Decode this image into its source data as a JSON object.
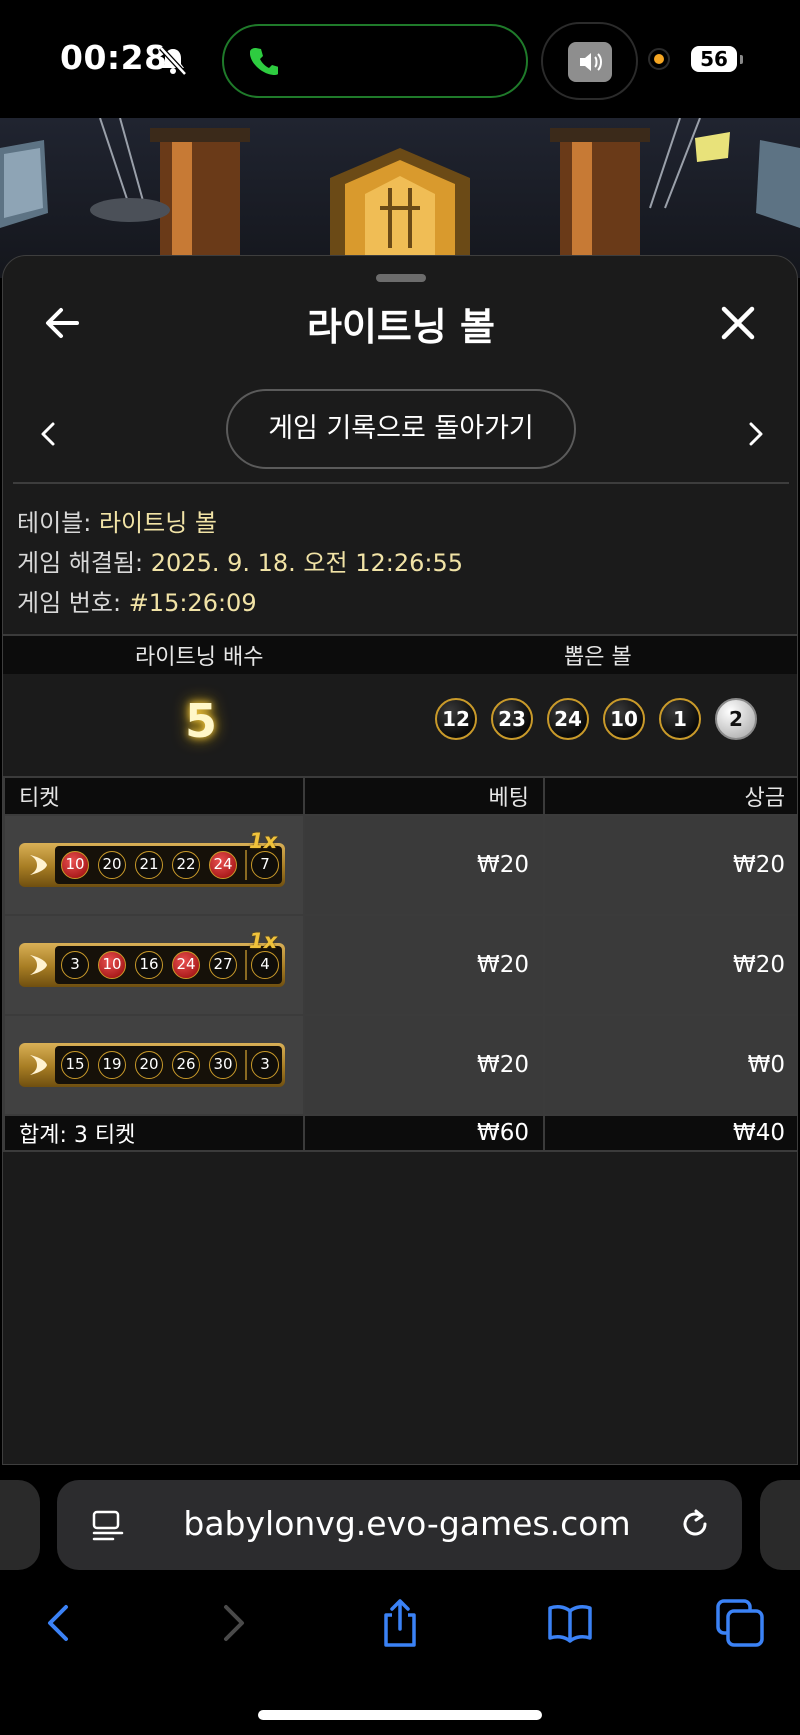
{
  "status_bar": {
    "time": "00:28",
    "battery": "56",
    "icons": [
      "bell-slash-icon",
      "phone-icon",
      "speaker-icon",
      "orange-dot-indicator"
    ]
  },
  "header": {
    "title": "라이트닝 볼",
    "back_icon": "arrow-left-icon",
    "close_icon": "close-icon"
  },
  "nav": {
    "back_to_history": "게임 기록으로 돌아가기",
    "prev_icon": "chevron-left-icon",
    "next_icon": "chevron-right-icon"
  },
  "info": {
    "table_label": "테이블:",
    "table_value": "라이트닝 볼",
    "resolved_label": "게임 해결됨:",
    "resolved_value": "2025. 9. 18. 오전 12:26:55",
    "game_no_label": "게임 번호:",
    "game_no_value": "#15:26:09"
  },
  "result": {
    "multiplier_header": "라이트닝 배수",
    "drawn_header": "뽑은 볼",
    "multiplier": "5",
    "drawn_balls": [
      "12",
      "23",
      "24",
      "10",
      "1",
      "2"
    ]
  },
  "tickets": {
    "headers": {
      "ticket": "티켓",
      "bet": "베팅",
      "payout": "상금"
    },
    "rows": [
      {
        "balls": [
          "10",
          "20",
          "21",
          "22",
          "24"
        ],
        "hits": [
          true,
          false,
          false,
          false,
          true
        ],
        "bonus": "7",
        "multiplier": "1x",
        "bet": "₩20",
        "payout": "₩20"
      },
      {
        "balls": [
          "3",
          "10",
          "16",
          "24",
          "27"
        ],
        "hits": [
          false,
          true,
          false,
          true,
          false
        ],
        "bonus": "4",
        "multiplier": "1x",
        "bet": "₩20",
        "payout": "₩20"
      },
      {
        "balls": [
          "15",
          "19",
          "20",
          "26",
          "30"
        ],
        "hits": [
          false,
          false,
          false,
          false,
          false
        ],
        "bonus": "3",
        "multiplier": "",
        "bet": "₩20",
        "payout": "₩0"
      }
    ],
    "total_label": "합계: 3 티켓",
    "total_bet": "₩60",
    "total_payout": "₩40"
  },
  "browser": {
    "url": "babylonvg.evo-games.com",
    "toolbar": [
      "back-icon",
      "forward-icon",
      "share-icon",
      "bookmarks-icon",
      "tabs-icon"
    ]
  },
  "colors": {
    "accent_gold": "#c99a2a",
    "value_text": "#f1e3a6",
    "link_blue": "#3b82f6",
    "hit_red": "#d23131"
  }
}
